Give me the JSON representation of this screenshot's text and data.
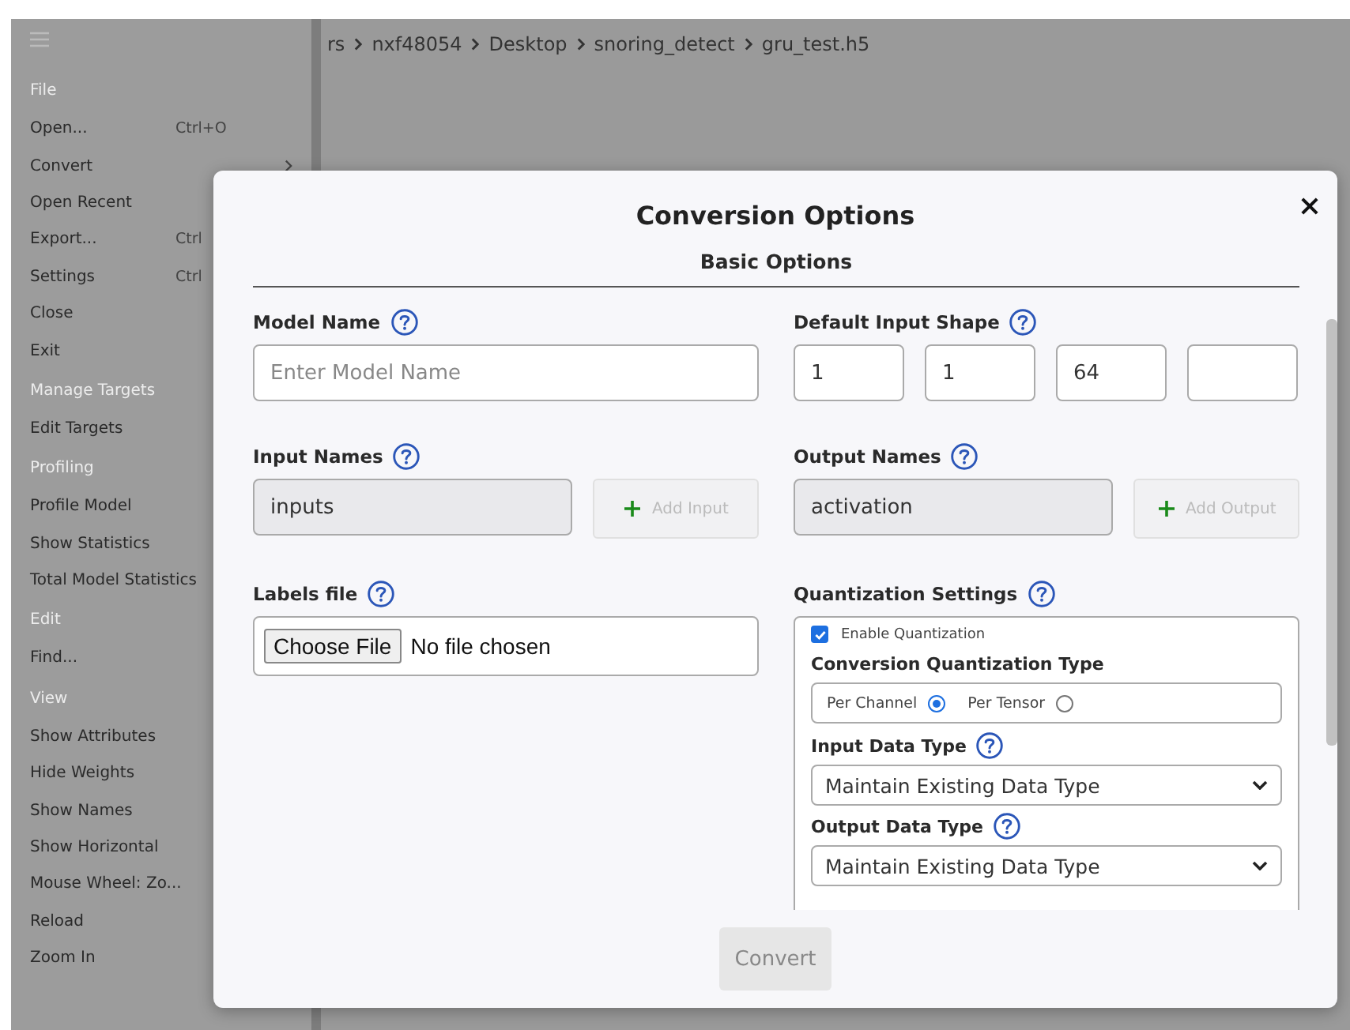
{
  "menu": {
    "sections": [
      {
        "heading": "File",
        "items": [
          {
            "label": "Open...",
            "shortcut": "Ctrl+O"
          },
          {
            "label": "Convert",
            "submenu": true
          },
          {
            "label": "Open Recent"
          },
          {
            "label": "Export...",
            "shortcut": "Ctrl"
          },
          {
            "label": "Settings",
            "shortcut": "Ctrl"
          },
          {
            "label": "Close"
          },
          {
            "label": "Exit"
          }
        ]
      },
      {
        "heading": "Manage Targets",
        "items": [
          {
            "label": "Edit Targets"
          }
        ]
      },
      {
        "heading": "Profiling",
        "items": [
          {
            "label": "Profile Model"
          },
          {
            "label": "Show Statistics"
          },
          {
            "label": "Total Model Statistics"
          }
        ]
      },
      {
        "heading": "Edit",
        "items": [
          {
            "label": "Find..."
          }
        ]
      },
      {
        "heading": "View",
        "items": [
          {
            "label": "Show Attributes"
          },
          {
            "label": "Hide Weights"
          },
          {
            "label": "Show Names"
          },
          {
            "label": "Show Horizontal"
          },
          {
            "label": "Mouse Wheel: Zo..."
          },
          {
            "label": "Reload"
          },
          {
            "label": "Zoom In"
          }
        ]
      }
    ]
  },
  "breadcrumb": [
    "rs",
    "nxf48054",
    "Desktop",
    "snoring_detect",
    "gru_test.h5"
  ],
  "dialog": {
    "title": "Conversion Options",
    "section": "Basic Options",
    "model_name": {
      "label": "Model Name",
      "placeholder": "Enter Model Name"
    },
    "input_shape": {
      "label": "Default Input Shape",
      "fields": [
        {
          "kind": "filled",
          "value": "1"
        },
        {
          "kind": "filled",
          "value": "1"
        },
        {
          "kind": "filled",
          "value": "64"
        },
        {
          "kind": "blank"
        }
      ]
    },
    "input_names": {
      "label": "Input Names",
      "value": "inputs",
      "button": "Add Input",
      "disabled": true
    },
    "output_names": {
      "label": "Output Names",
      "value": "activation",
      "button": "Add Output",
      "disabled": true
    },
    "labels_file": {
      "label": "Labels file",
      "button": "Choose File",
      "status": "No file chosen"
    },
    "quantization": {
      "label": "Quantization Settings",
      "enable": {
        "label": "Enable Quantization",
        "checked": true
      },
      "type_label": "Conversion Quantization Type",
      "types": [
        {
          "label": "Per Channel",
          "selected": true
        },
        {
          "label": "Per Tensor",
          "selected": false
        }
      ],
      "input_type": {
        "label": "Input Data Type",
        "value": "Maintain Existing Data Type"
      },
      "output_type": {
        "label": "Output Data Type",
        "value": "Maintain Existing Data Type"
      }
    },
    "convert_button": {
      "label": "Convert",
      "disabled": true
    }
  }
}
